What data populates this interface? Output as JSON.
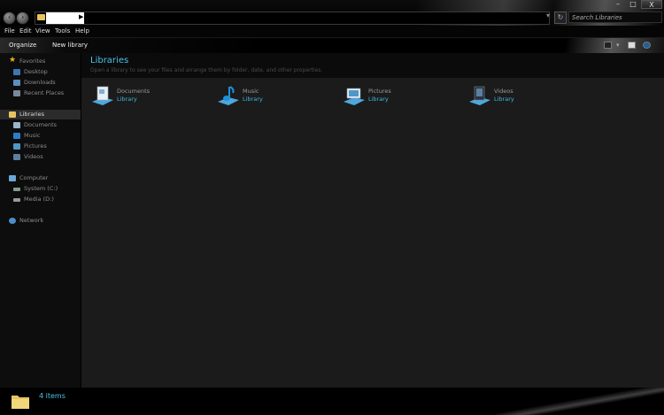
{
  "address_bar": {
    "search_placeholder": "Search Libraries",
    "window_controls": {
      "minimize": "–",
      "maximize": "□",
      "close": "X"
    }
  },
  "menu": [
    "File",
    "Edit",
    "View",
    "Tools",
    "Help"
  ],
  "toolbar": {
    "organize": "Organize",
    "new_library": "New library"
  },
  "nav": {
    "favorites": {
      "label": "Favorites",
      "items": [
        "Desktop",
        "Downloads",
        "Recent Places"
      ]
    },
    "libraries": {
      "label": "Libraries",
      "items": [
        "Documents",
        "Music",
        "Pictures",
        "Videos"
      ]
    },
    "computer": {
      "label": "Computer",
      "items": [
        "System (C:)",
        "Media (D:)"
      ]
    },
    "network": {
      "label": "Network"
    }
  },
  "content": {
    "title": "Libraries",
    "subtitle": "Open a library to see your files and arrange them by folder, date, and other properties.",
    "libraries": [
      {
        "name": "Documents",
        "type": "Library",
        "icon": "documents-library-icon"
      },
      {
        "name": "Music",
        "type": "Library",
        "icon": "music-library-icon"
      },
      {
        "name": "Pictures",
        "type": "Library",
        "icon": "pictures-library-icon"
      },
      {
        "name": "Videos",
        "type": "Library",
        "icon": "videos-library-icon"
      }
    ]
  },
  "status": {
    "item_count": "4 items"
  },
  "colors": {
    "accent": "#49c4e8",
    "background": "#1b1b1b",
    "nav_bg": "#0d0d0d"
  }
}
